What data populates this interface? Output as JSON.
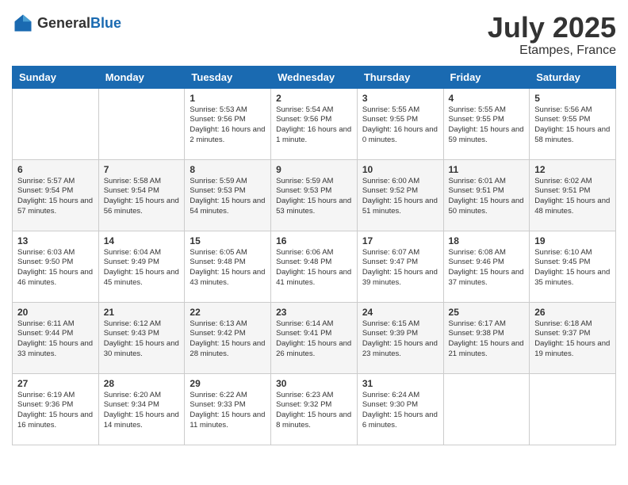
{
  "logo": {
    "general": "General",
    "blue": "Blue"
  },
  "header": {
    "month": "July 2025",
    "location": "Etampes, France"
  },
  "weekdays": [
    "Sunday",
    "Monday",
    "Tuesday",
    "Wednesday",
    "Thursday",
    "Friday",
    "Saturday"
  ],
  "weeks": [
    [
      {
        "day": "",
        "info": ""
      },
      {
        "day": "",
        "info": ""
      },
      {
        "day": "1",
        "info": "Sunrise: 5:53 AM\nSunset: 9:56 PM\nDaylight: 16 hours\nand 2 minutes."
      },
      {
        "day": "2",
        "info": "Sunrise: 5:54 AM\nSunset: 9:56 PM\nDaylight: 16 hours\nand 1 minute."
      },
      {
        "day": "3",
        "info": "Sunrise: 5:55 AM\nSunset: 9:55 PM\nDaylight: 16 hours\nand 0 minutes."
      },
      {
        "day": "4",
        "info": "Sunrise: 5:55 AM\nSunset: 9:55 PM\nDaylight: 15 hours\nand 59 minutes."
      },
      {
        "day": "5",
        "info": "Sunrise: 5:56 AM\nSunset: 9:55 PM\nDaylight: 15 hours\nand 58 minutes."
      }
    ],
    [
      {
        "day": "6",
        "info": "Sunrise: 5:57 AM\nSunset: 9:54 PM\nDaylight: 15 hours\nand 57 minutes."
      },
      {
        "day": "7",
        "info": "Sunrise: 5:58 AM\nSunset: 9:54 PM\nDaylight: 15 hours\nand 56 minutes."
      },
      {
        "day": "8",
        "info": "Sunrise: 5:59 AM\nSunset: 9:53 PM\nDaylight: 15 hours\nand 54 minutes."
      },
      {
        "day": "9",
        "info": "Sunrise: 5:59 AM\nSunset: 9:53 PM\nDaylight: 15 hours\nand 53 minutes."
      },
      {
        "day": "10",
        "info": "Sunrise: 6:00 AM\nSunset: 9:52 PM\nDaylight: 15 hours\nand 51 minutes."
      },
      {
        "day": "11",
        "info": "Sunrise: 6:01 AM\nSunset: 9:51 PM\nDaylight: 15 hours\nand 50 minutes."
      },
      {
        "day": "12",
        "info": "Sunrise: 6:02 AM\nSunset: 9:51 PM\nDaylight: 15 hours\nand 48 minutes."
      }
    ],
    [
      {
        "day": "13",
        "info": "Sunrise: 6:03 AM\nSunset: 9:50 PM\nDaylight: 15 hours\nand 46 minutes."
      },
      {
        "day": "14",
        "info": "Sunrise: 6:04 AM\nSunset: 9:49 PM\nDaylight: 15 hours\nand 45 minutes."
      },
      {
        "day": "15",
        "info": "Sunrise: 6:05 AM\nSunset: 9:48 PM\nDaylight: 15 hours\nand 43 minutes."
      },
      {
        "day": "16",
        "info": "Sunrise: 6:06 AM\nSunset: 9:48 PM\nDaylight: 15 hours\nand 41 minutes."
      },
      {
        "day": "17",
        "info": "Sunrise: 6:07 AM\nSunset: 9:47 PM\nDaylight: 15 hours\nand 39 minutes."
      },
      {
        "day": "18",
        "info": "Sunrise: 6:08 AM\nSunset: 9:46 PM\nDaylight: 15 hours\nand 37 minutes."
      },
      {
        "day": "19",
        "info": "Sunrise: 6:10 AM\nSunset: 9:45 PM\nDaylight: 15 hours\nand 35 minutes."
      }
    ],
    [
      {
        "day": "20",
        "info": "Sunrise: 6:11 AM\nSunset: 9:44 PM\nDaylight: 15 hours\nand 33 minutes."
      },
      {
        "day": "21",
        "info": "Sunrise: 6:12 AM\nSunset: 9:43 PM\nDaylight: 15 hours\nand 30 minutes."
      },
      {
        "day": "22",
        "info": "Sunrise: 6:13 AM\nSunset: 9:42 PM\nDaylight: 15 hours\nand 28 minutes."
      },
      {
        "day": "23",
        "info": "Sunrise: 6:14 AM\nSunset: 9:41 PM\nDaylight: 15 hours\nand 26 minutes."
      },
      {
        "day": "24",
        "info": "Sunrise: 6:15 AM\nSunset: 9:39 PM\nDaylight: 15 hours\nand 23 minutes."
      },
      {
        "day": "25",
        "info": "Sunrise: 6:17 AM\nSunset: 9:38 PM\nDaylight: 15 hours\nand 21 minutes."
      },
      {
        "day": "26",
        "info": "Sunrise: 6:18 AM\nSunset: 9:37 PM\nDaylight: 15 hours\nand 19 minutes."
      }
    ],
    [
      {
        "day": "27",
        "info": "Sunrise: 6:19 AM\nSunset: 9:36 PM\nDaylight: 15 hours\nand 16 minutes."
      },
      {
        "day": "28",
        "info": "Sunrise: 6:20 AM\nSunset: 9:34 PM\nDaylight: 15 hours\nand 14 minutes."
      },
      {
        "day": "29",
        "info": "Sunrise: 6:22 AM\nSunset: 9:33 PM\nDaylight: 15 hours\nand 11 minutes."
      },
      {
        "day": "30",
        "info": "Sunrise: 6:23 AM\nSunset: 9:32 PM\nDaylight: 15 hours\nand 8 minutes."
      },
      {
        "day": "31",
        "info": "Sunrise: 6:24 AM\nSunset: 9:30 PM\nDaylight: 15 hours\nand 6 minutes."
      },
      {
        "day": "",
        "info": ""
      },
      {
        "day": "",
        "info": ""
      }
    ]
  ]
}
